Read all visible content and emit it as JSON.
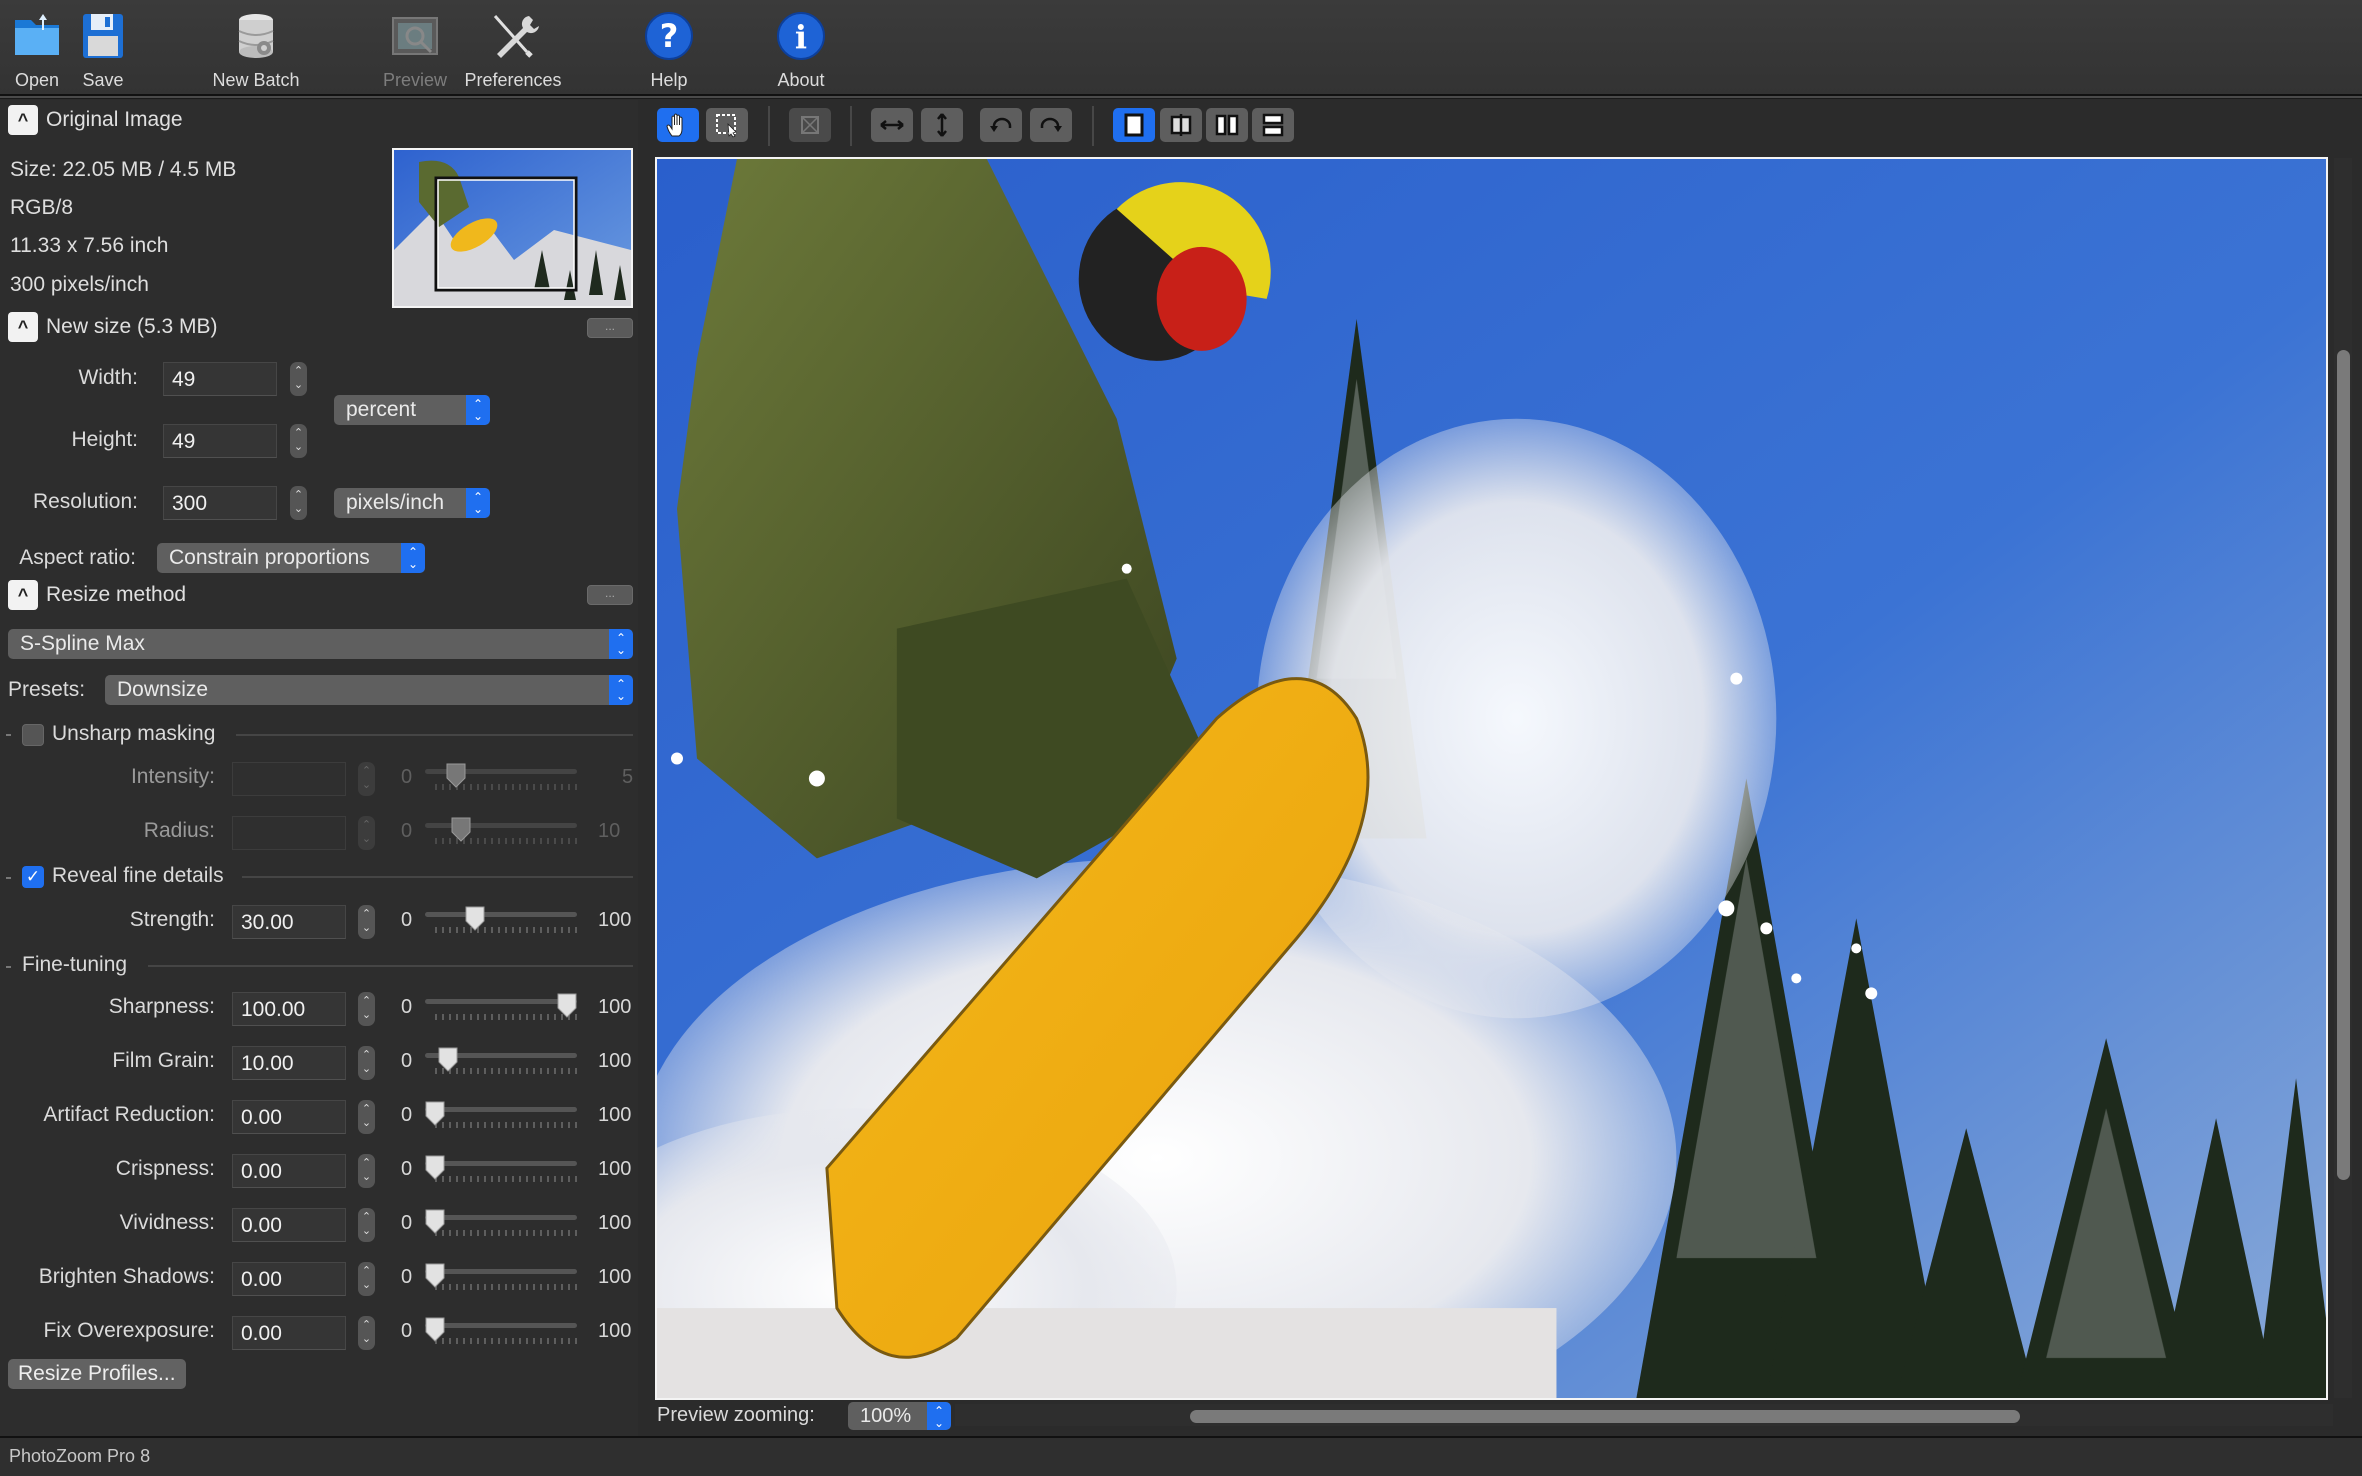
{
  "app": {
    "title": "PhotoZoom Pro 8"
  },
  "toolbar": {
    "buttons": [
      {
        "label": "Open",
        "icon": "folder-icon",
        "enabled": true
      },
      {
        "label": "Save",
        "icon": "floppy-disk-icon",
        "enabled": true
      },
      {
        "label": "New Batch",
        "icon": "batch-database-icon",
        "enabled": true
      },
      {
        "label": "Preview",
        "icon": "preview-image-icon",
        "enabled": false
      },
      {
        "label": "Preferences",
        "icon": "wrench-screwdriver-icon",
        "enabled": true
      },
      {
        "label": "Help",
        "icon": "question-icon",
        "enabled": true
      },
      {
        "label": "About",
        "icon": "info-icon",
        "enabled": true
      }
    ]
  },
  "original_image": {
    "title": "Original Image",
    "size": "Size: 22.05 MB / 4.5 MB",
    "mode": "RGB/8",
    "dimensions": "11.33 x 7.56 inch",
    "resolution": "300 pixels/inch",
    "collapse_icon": "chevron-up-icon"
  },
  "new_size": {
    "title": "New size (5.3 MB)",
    "more_label": "...",
    "width_label": "Width:",
    "width_value": "49",
    "height_label": "Height:",
    "height_value": "49",
    "unit": "percent",
    "resolution_label": "Resolution:",
    "resolution_value": "300",
    "resolution_unit": "pixels/inch",
    "aspect_label": "Aspect ratio:",
    "aspect_value": "Constrain proportions"
  },
  "resize_method": {
    "title": "Resize method",
    "more_label": "...",
    "method": "S-Spline Max",
    "presets_label": "Presets:",
    "preset": "Downsize"
  },
  "unsharp": {
    "label": "Unsharp masking",
    "checked": false,
    "controls": [
      {
        "label": "Intensity:",
        "value": "",
        "min": "0",
        "max": "5",
        "position": 0.16
      },
      {
        "label": "Radius:",
        "value": "",
        "min": "0",
        "max": "10",
        "position": 0.2
      }
    ]
  },
  "reveal": {
    "label": "Reveal fine details",
    "checked": true,
    "controls": [
      {
        "label": "Strength:",
        "value": "30.00",
        "min": "0",
        "max": "100",
        "position": 0.3
      }
    ]
  },
  "fine_tuning": {
    "label": "Fine-tuning",
    "controls": [
      {
        "label": "Sharpness:",
        "value": "100.00",
        "min": "0",
        "max": "100",
        "position": 1.0
      },
      {
        "label": "Film Grain:",
        "value": "10.00",
        "min": "0",
        "max": "100",
        "position": 0.1
      },
      {
        "label": "Artifact Reduction:",
        "value": "0.00",
        "min": "0",
        "max": "100",
        "position": 0
      },
      {
        "label": "Crispness:",
        "value": "0.00",
        "min": "0",
        "max": "100",
        "position": 0
      },
      {
        "label": "Vividness:",
        "value": "0.00",
        "min": "0",
        "max": "100",
        "position": 0
      },
      {
        "label": "Brighten Shadows:",
        "value": "0.00",
        "min": "0",
        "max": "100",
        "position": 0
      },
      {
        "label": "Fix Overexposure:",
        "value": "0.00",
        "min": "0",
        "max": "100",
        "position": 0
      }
    ]
  },
  "resize_profiles_label": "Resize Profiles...",
  "image_toolbar": {
    "tools": [
      {
        "name": "hand-tool",
        "icon": "hand-icon",
        "active": true
      },
      {
        "name": "crop-select-tool",
        "icon": "selection-icon",
        "active": false
      },
      {
        "name": "crop-tool",
        "icon": "crop-icon",
        "disabled": true
      },
      {
        "name": "flip-horizontal",
        "icon": "arrow-left-right-icon"
      },
      {
        "name": "flip-vertical",
        "icon": "arrow-up-down-icon"
      },
      {
        "name": "rotate-left",
        "icon": "rotate-ccw-icon"
      },
      {
        "name": "rotate-right",
        "icon": "rotate-cw-icon"
      },
      {
        "name": "single-view",
        "icon": "single-view-icon",
        "active": true
      },
      {
        "name": "split-view",
        "icon": "split-view-icon"
      },
      {
        "name": "side-by-side-view",
        "icon": "side-by-side-icon"
      },
      {
        "name": "stacked-view",
        "icon": "stacked-view-icon"
      }
    ]
  },
  "preview": {
    "zoom_label": "Preview zooming:",
    "zoom_value": "100%",
    "image_description": "Snowboarder jumping through powder with yellow board against blue sky and snowy pine trees"
  },
  "scroll": {
    "horizontal_position": 0.55,
    "vertical_position": 0.45
  },
  "colors": {
    "accent": "#1f6ff0",
    "panel": "#2d2d2d",
    "toolbar": "#383838"
  }
}
